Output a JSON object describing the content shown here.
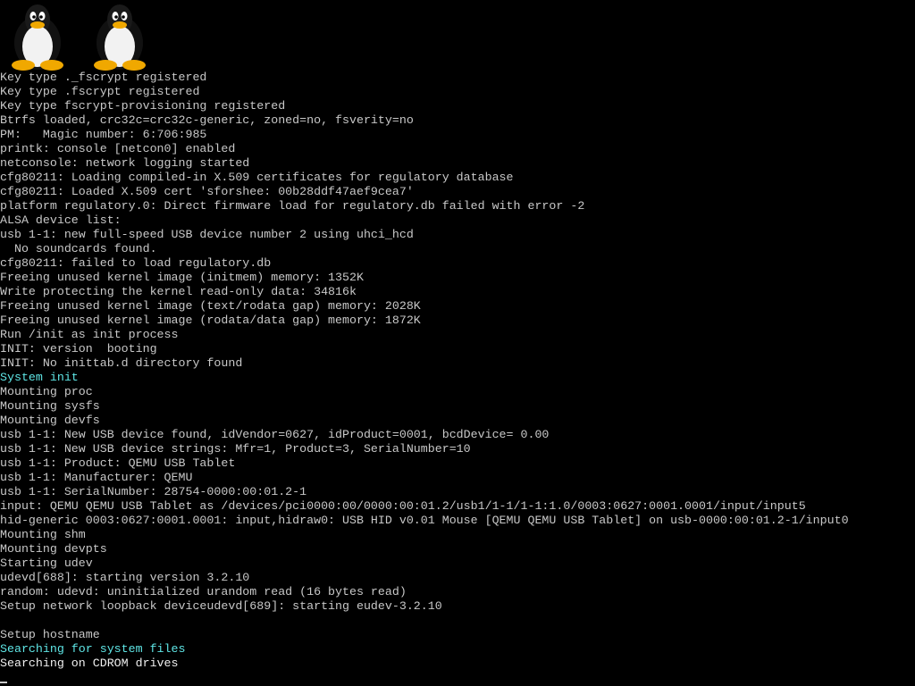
{
  "logo": {
    "icons": [
      "tux-penguin-icon",
      "tux-penguin-icon"
    ]
  },
  "colors": {
    "background": "#000000",
    "text": "#c8c8c8",
    "highlight_cyan": "#5fe6e6",
    "highlight_white": "#f0f0f0"
  },
  "console": {
    "lines": [
      {
        "text": "Key type ._fscrypt registered",
        "style": "normal"
      },
      {
        "text": "Key type .fscrypt registered",
        "style": "normal"
      },
      {
        "text": "Key type fscrypt-provisioning registered",
        "style": "normal"
      },
      {
        "text": "Btrfs loaded, crc32c=crc32c-generic, zoned=no, fsverity=no",
        "style": "normal"
      },
      {
        "text": "PM:   Magic number: 6:706:985",
        "style": "normal"
      },
      {
        "text": "printk: console [netcon0] enabled",
        "style": "normal"
      },
      {
        "text": "netconsole: network logging started",
        "style": "normal"
      },
      {
        "text": "cfg80211: Loading compiled-in X.509 certificates for regulatory database",
        "style": "normal"
      },
      {
        "text": "cfg80211: Loaded X.509 cert 'sforshee: 00b28ddf47aef9cea7'",
        "style": "normal"
      },
      {
        "text": "platform regulatory.0: Direct firmware load for regulatory.db failed with error -2",
        "style": "normal"
      },
      {
        "text": "ALSA device list:",
        "style": "normal"
      },
      {
        "text": "usb 1-1: new full-speed USB device number 2 using uhci_hcd",
        "style": "normal"
      },
      {
        "text": "  No soundcards found.",
        "style": "normal"
      },
      {
        "text": "cfg80211: failed to load regulatory.db",
        "style": "normal"
      },
      {
        "text": "Freeing unused kernel image (initmem) memory: 1352K",
        "style": "normal"
      },
      {
        "text": "Write protecting the kernel read-only data: 34816k",
        "style": "normal"
      },
      {
        "text": "Freeing unused kernel image (text/rodata gap) memory: 2028K",
        "style": "normal"
      },
      {
        "text": "Freeing unused kernel image (rodata/data gap) memory: 1872K",
        "style": "normal"
      },
      {
        "text": "Run /init as init process",
        "style": "normal"
      },
      {
        "text": "INIT: version  booting",
        "style": "normal"
      },
      {
        "text": "INIT: No inittab.d directory found",
        "style": "normal"
      },
      {
        "text": "System init",
        "style": "cyan"
      },
      {
        "text": "Mounting proc",
        "style": "normal"
      },
      {
        "text": "Mounting sysfs",
        "style": "normal"
      },
      {
        "text": "Mounting devfs",
        "style": "normal"
      },
      {
        "text": "usb 1-1: New USB device found, idVendor=0627, idProduct=0001, bcdDevice= 0.00",
        "style": "normal"
      },
      {
        "text": "usb 1-1: New USB device strings: Mfr=1, Product=3, SerialNumber=10",
        "style": "normal"
      },
      {
        "text": "usb 1-1: Product: QEMU USB Tablet",
        "style": "normal"
      },
      {
        "text": "usb 1-1: Manufacturer: QEMU",
        "style": "normal"
      },
      {
        "text": "usb 1-1: SerialNumber: 28754-0000:00:01.2-1",
        "style": "normal"
      },
      {
        "text": "input: QEMU QEMU USB Tablet as /devices/pci0000:00/0000:00:01.2/usb1/1-1/1-1:1.0/0003:0627:0001.0001/input/input5",
        "style": "normal"
      },
      {
        "text": "hid-generic 0003:0627:0001.0001: input,hidraw0: USB HID v0.01 Mouse [QEMU QEMU USB Tablet] on usb-0000:00:01.2-1/input0",
        "style": "normal"
      },
      {
        "text": "Mounting shm",
        "style": "normal"
      },
      {
        "text": "Mounting devpts",
        "style": "normal"
      },
      {
        "text": "Starting udev",
        "style": "normal"
      },
      {
        "text": "udevd[688]: starting version 3.2.10",
        "style": "normal"
      },
      {
        "text": "random: udevd: uninitialized urandom read (16 bytes read)",
        "style": "normal"
      },
      {
        "text": "Setup network loopback deviceudevd[689]: starting eudev-3.2.10",
        "style": "normal"
      },
      {
        "text": "",
        "style": "normal"
      },
      {
        "text": "Setup hostname",
        "style": "normal"
      },
      {
        "text": "Searching for system files",
        "style": "cyan"
      },
      {
        "text": "Searching on CDROM drives",
        "style": "white"
      }
    ]
  }
}
